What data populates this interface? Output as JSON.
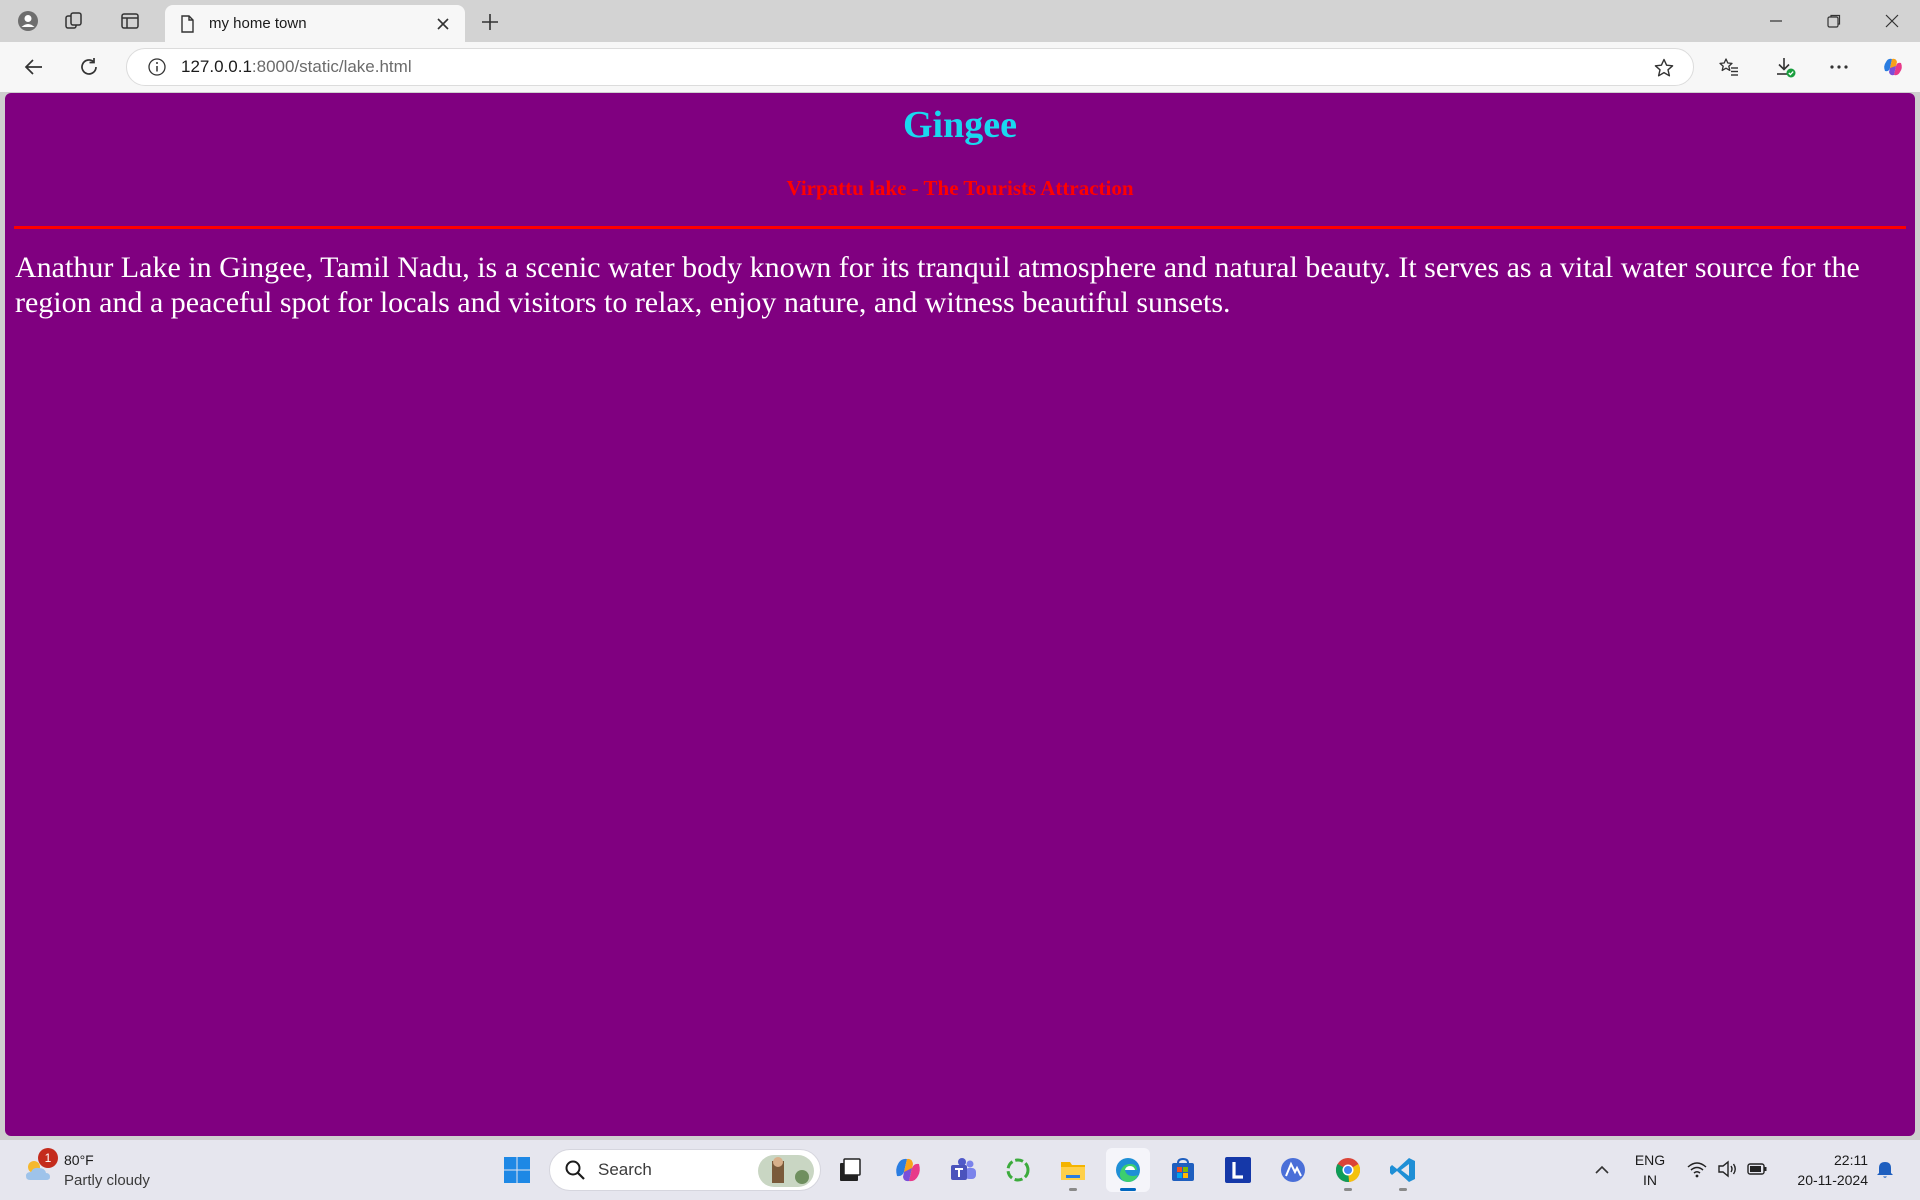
{
  "browser": {
    "tab_title": "my home town",
    "url_host": "127.0.0.1",
    "url_path": ":8000/static/lake.html"
  },
  "page": {
    "title": "Gingee",
    "subtitle": "Virpattu lake - The Tourists Attraction",
    "body": "Anathur Lake in Gingee, Tamil Nadu, is a scenic water body known for its tranquil atmosphere and natural beauty. It serves as a vital water source for the region and a peaceful spot for locals and visitors to relax, enjoy nature, and witness beautiful sunsets.",
    "colors": {
      "background": "#800080",
      "title": "#19d8f0",
      "subtitle": "#ff0000",
      "rule": "#ff0000",
      "body_text": "#ffffff"
    }
  },
  "taskbar": {
    "weather_temp": "80°F",
    "weather_condition": "Partly cloudy",
    "weather_badge": "1",
    "search_label": "Search",
    "language_line1": "ENG",
    "language_line2": "IN",
    "time": "22:11",
    "date": "20-11-2024",
    "apps": [
      "start-icon",
      "task-view-icon",
      "copilot-icon",
      "teams-icon",
      "refresh-app-icon",
      "file-explorer-icon",
      "edge-icon",
      "store-icon",
      "l-app-icon",
      "vpn-app-icon",
      "chrome-icon",
      "vscode-icon"
    ]
  }
}
